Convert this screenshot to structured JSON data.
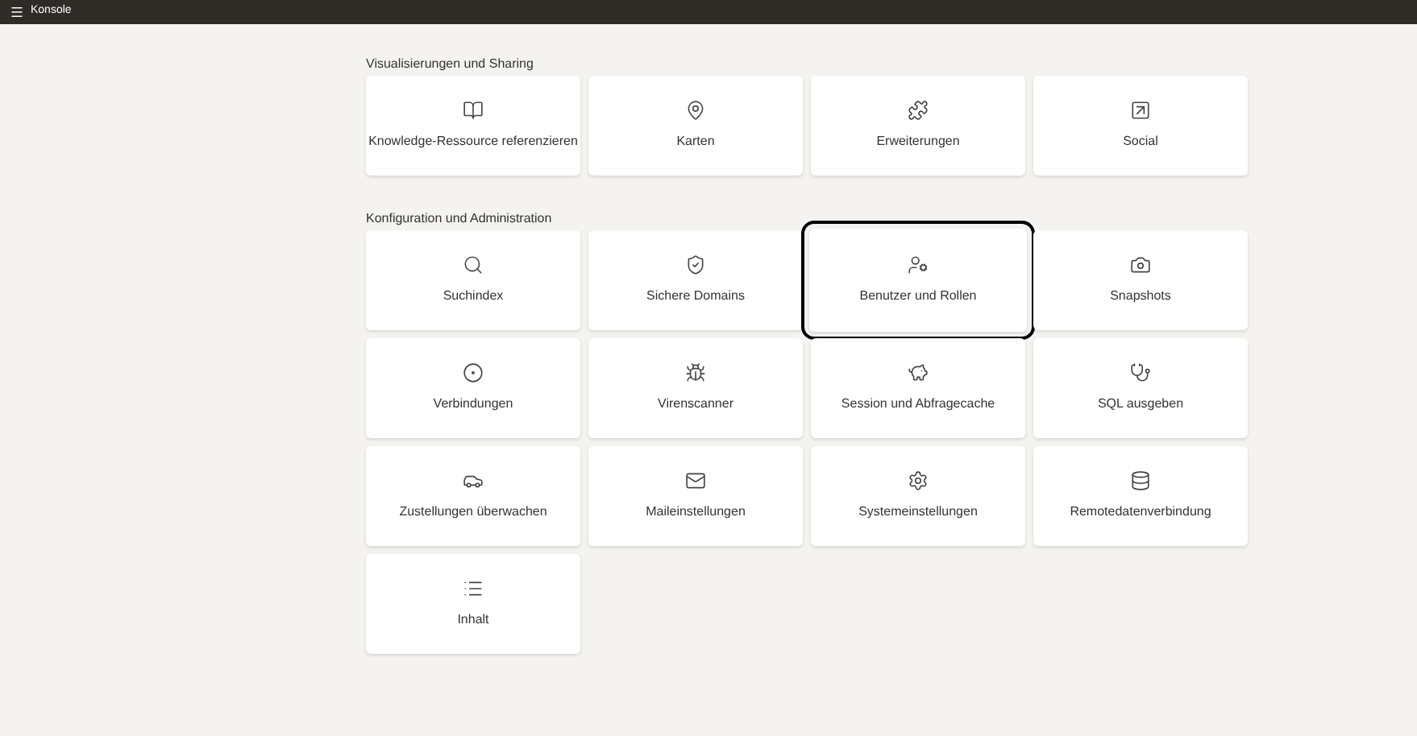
{
  "topbar": {
    "title": "Konsole"
  },
  "sections": [
    {
      "title": "Visualisierungen und Sharing",
      "tiles": [
        {
          "label": "Knowledge-Ressource referenzieren",
          "highlighted": false
        },
        {
          "label": "Karten",
          "highlighted": false
        },
        {
          "label": "Erweiterungen",
          "highlighted": false
        },
        {
          "label": "Social",
          "highlighted": false
        }
      ]
    },
    {
      "title": "Konfiguration und Administration",
      "tiles": [
        {
          "label": "Suchindex",
          "highlighted": false
        },
        {
          "label": "Sichere Domains",
          "highlighted": false
        },
        {
          "label": "Benutzer und Rollen",
          "highlighted": true
        },
        {
          "label": "Snapshots",
          "highlighted": false
        },
        {
          "label": "Verbindungen",
          "highlighted": false
        },
        {
          "label": "Virenscanner",
          "highlighted": false
        },
        {
          "label": "Session und Abfragecache",
          "highlighted": false
        },
        {
          "label": "SQL ausgeben",
          "highlighted": false
        },
        {
          "label": "Zustellungen überwachen",
          "highlighted": false
        },
        {
          "label": "Maileinstellungen",
          "highlighted": false
        },
        {
          "label": "Systemeinstellungen",
          "highlighted": false
        },
        {
          "label": "Remotedatenverbindung",
          "highlighted": false
        },
        {
          "label": "Inhalt",
          "highlighted": false
        }
      ]
    }
  ]
}
